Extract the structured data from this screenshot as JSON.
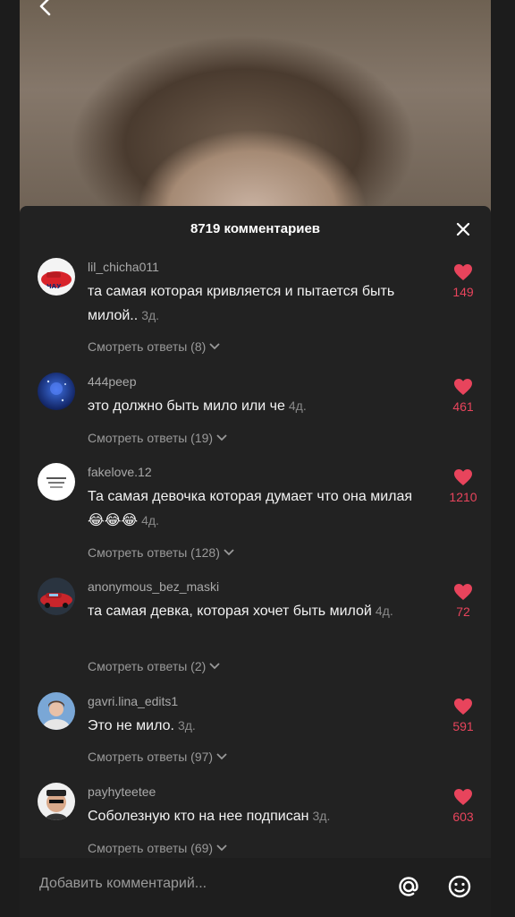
{
  "header": {
    "title": "8719 комментариев"
  },
  "comments": [
    {
      "user": "lil_chicha011",
      "text": "та самая которая кривляется и пытается быть милой..",
      "time": "3д.",
      "replies": "Смотреть ответы (8)",
      "likes": "149"
    },
    {
      "user": "444peep",
      "text": "это должно быть мило или че",
      "time": "4д.",
      "replies": "Смотреть ответы (19)",
      "likes": "461"
    },
    {
      "user": "fakelove.12",
      "text": "Та самая девочка которая думает что она милая 😂😂😂",
      "time": "4д.",
      "replies": "Смотреть ответы (128)",
      "likes": "1210"
    },
    {
      "user": "anonymous_bez_maski",
      "text": "та самая девка, которая хочет быть милой",
      "time": "4д.",
      "replies": "Смотреть ответы (2)",
      "likes": "72"
    },
    {
      "user": "gavri.lina_edits1",
      "text": "Это не мило.",
      "time": "3д.",
      "replies": "Смотреть ответы (97)",
      "likes": "591"
    },
    {
      "user": "payhyteetee",
      "text": "Соболезную кто на нее подписан",
      "time": "3д.",
      "replies": "Смотреть ответы (69)",
      "likes": "603"
    }
  ],
  "input": {
    "placeholder": "Добавить комментарий..."
  },
  "colors": {
    "accent": "#e8445c",
    "sheet": "#222222",
    "muted": "#9a9a9a"
  },
  "icons": [
    "back-icon",
    "close-icon",
    "heart-icon",
    "chevron-down-icon",
    "at-icon",
    "emoji-icon"
  ]
}
